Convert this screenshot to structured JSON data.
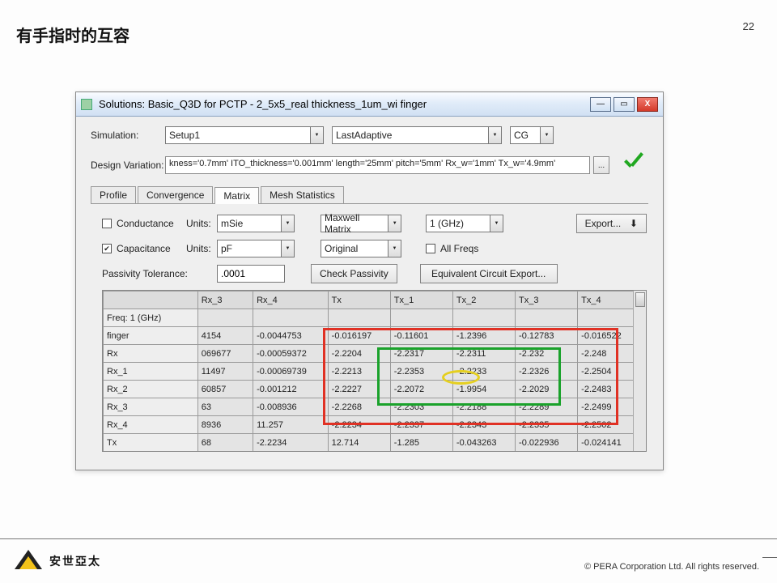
{
  "slide": {
    "title": "有手指时的互容",
    "page_num": "22"
  },
  "window": {
    "title": "Solutions: Basic_Q3D for PCTP - 2_5x5_real thickness_1um_wi finger",
    "win_min": "—",
    "win_max": "▭",
    "win_close": "X"
  },
  "sim": {
    "label": "Simulation:",
    "setup": "Setup1",
    "pass": "LastAdaptive",
    "solver": "CG"
  },
  "dv": {
    "label": "Design Variation:",
    "value": "kness='0.7mm' ITO_thickness='0.001mm' length='25mm' pitch='5mm' Rx_w='1mm' Tx_w='4.9mm'",
    "more": "..."
  },
  "tabs": [
    "Profile",
    "Convergence",
    "Matrix",
    "Mesh Statistics"
  ],
  "matrix": {
    "conductance_label": "Conductance",
    "capacitance_label": "Capacitance",
    "units_label": "Units:",
    "cond_units": "mSie",
    "cap_units": "pF",
    "maxwell": "Maxwell Matrix",
    "original": "Original",
    "freq_sel": "1 (GHz)",
    "allfreqs": "All Freqs",
    "export": "Export...",
    "passivity_label": "Passivity Tolerance:",
    "passivity_val": ".0001",
    "check_passivity": "Check Passivity",
    "equiv_export": "Equivalent Circuit Export..."
  },
  "table": {
    "cols": [
      "",
      "Rx_3",
      "Rx_4",
      "Tx",
      "Tx_1",
      "Tx_2",
      "Tx_3",
      "Tx_4"
    ],
    "rows": [
      {
        "h": "Freq: 1 (GHz)",
        "c": [
          "",
          "",
          "",
          "",
          "",
          "",
          ""
        ]
      },
      {
        "h": "finger",
        "c": [
          "4154",
          "-0.0044753",
          "-0.016197",
          "-0.11601",
          "-1.2396",
          "-0.12783",
          "-0.016522"
        ]
      },
      {
        "h": "Rx",
        "c": [
          "069677",
          "-0.00059372",
          "-2.2204",
          "-2.2317",
          "-2.2311",
          "-2.232",
          "-2.248"
        ]
      },
      {
        "h": "Rx_1",
        "c": [
          "11497",
          "-0.00069739",
          "-2.2213",
          "-2.2353",
          "-2.2233",
          "-2.2326",
          "-2.2504"
        ]
      },
      {
        "h": "Rx_2",
        "c": [
          "60857",
          "-0.001212",
          "-2.2227",
          "-2.2072",
          "-1.9954",
          "-2.2029",
          "-2.2483"
        ]
      },
      {
        "h": "Rx_3",
        "c": [
          "63",
          "-0.008936",
          "-2.2268",
          "-2.2303",
          "-2.2188",
          "-2.2289",
          "-2.2499"
        ]
      },
      {
        "h": "Rx_4",
        "c": [
          "8936",
          "11.257",
          "-2.2234",
          "-2.2337",
          "-2.2343",
          "-2.2335",
          "-2.2502"
        ]
      },
      {
        "h": "Tx",
        "c": [
          "68",
          "-2.2234",
          "12.714",
          "-1.285",
          "-0.043263",
          "-0.022936",
          "-0.024141"
        ]
      }
    ]
  },
  "footer": {
    "brand": "安世亞太",
    "copyright": "©  PERA Corporation Ltd. All rights\nreserved."
  }
}
